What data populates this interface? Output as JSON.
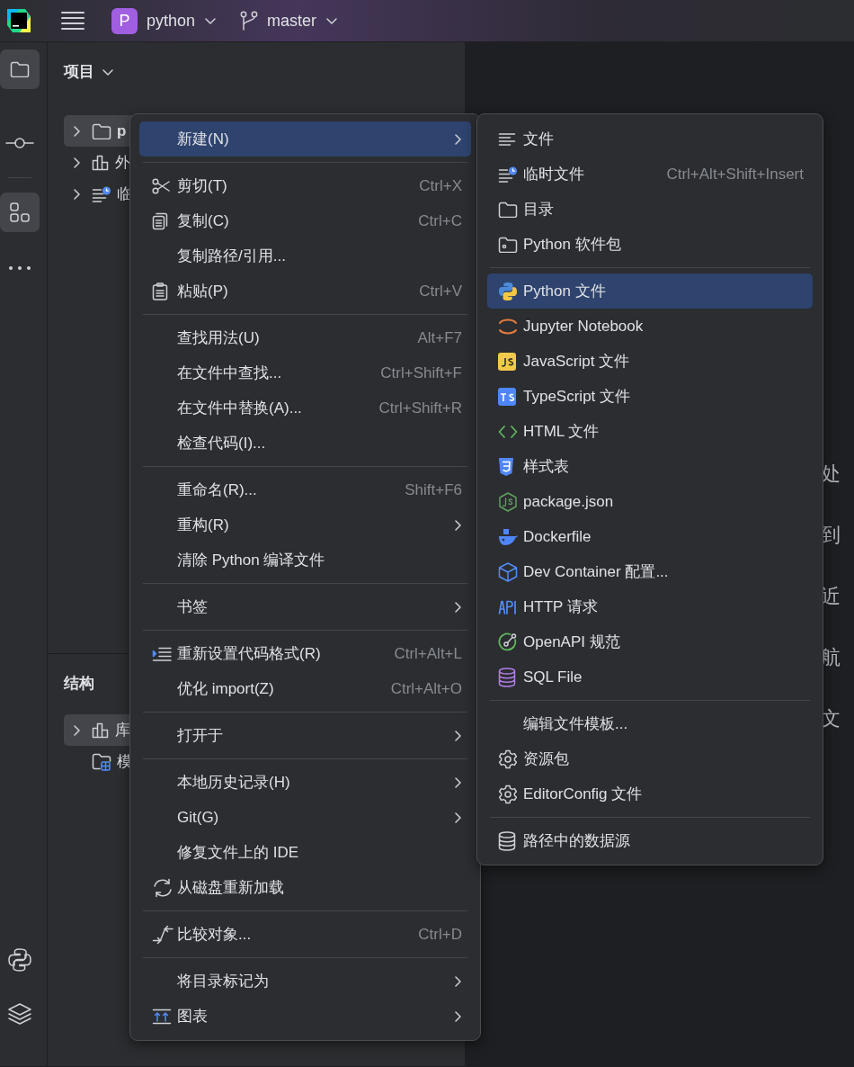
{
  "top_bar": {
    "project_initial": "P",
    "project": "python",
    "branch": "master"
  },
  "tool_rail": {
    "top": [
      {
        "kind": "folder",
        "selected": true
      },
      {
        "kind": "commit",
        "selected": false
      },
      {
        "kind": "structure",
        "selected": true
      },
      {
        "kind": "more",
        "selected": false
      }
    ],
    "bottom": [
      {
        "kind": "python",
        "selected": false
      },
      {
        "kind": "layers",
        "selected": false
      }
    ]
  },
  "project_panel": {
    "title": "项目",
    "tree": [
      {
        "label": "p",
        "kind": "folder",
        "selected": true
      },
      {
        "label": "外",
        "kind": "library",
        "selected": false
      },
      {
        "label": "临",
        "kind": "scratch",
        "selected": false
      }
    ]
  },
  "structure_panel": {
    "title": "结构",
    "tree": [
      {
        "label": "库",
        "kind": "library",
        "selected": true,
        "expandable": true
      },
      {
        "label": "模",
        "kind": "module",
        "selected": false,
        "expandable": false
      }
    ]
  },
  "editor_hints": [
    "处",
    "到",
    "近",
    "航",
    "文"
  ],
  "context_menu": {
    "sections": [
      [
        {
          "label": "新建(N)",
          "submenu": true,
          "selected": true
        }
      ],
      [
        {
          "label": "剪切(T)",
          "kind": "scissors",
          "shortcut": "Ctrl+X",
          "selected": false
        },
        {
          "label": "复制(C)",
          "kind": "copy",
          "shortcut": "Ctrl+C",
          "selected": false
        },
        {
          "label": "复制路径/引用...",
          "selected": false
        },
        {
          "label": "粘贴(P)",
          "kind": "paste",
          "shortcut": "Ctrl+V",
          "selected": false
        }
      ],
      [
        {
          "label": "查找用法(U)",
          "shortcut": "Alt+F7",
          "selected": false
        },
        {
          "label": "在文件中查找...",
          "shortcut": "Ctrl+Shift+F",
          "selected": false
        },
        {
          "label": "在文件中替换(A)...",
          "shortcut": "Ctrl+Shift+R",
          "selected": false
        },
        {
          "label": "检查代码(I)...",
          "selected": false
        }
      ],
      [
        {
          "label": "重命名(R)...",
          "shortcut": "Shift+F6",
          "selected": false
        },
        {
          "label": "重构(R)",
          "submenu": true,
          "selected": false
        },
        {
          "label": "清除 Python 编译文件",
          "selected": false
        }
      ],
      [
        {
          "label": "书签",
          "submenu": true,
          "selected": false
        }
      ],
      [
        {
          "label": "重新设置代码格式(R)",
          "kind": "reformat",
          "shortcut": "Ctrl+Alt+L",
          "selected": false
        },
        {
          "label": "优化 import(Z)",
          "shortcut": "Ctrl+Alt+O",
          "selected": false
        }
      ],
      [
        {
          "label": "打开于",
          "submenu": true,
          "selected": false
        }
      ],
      [
        {
          "label": "本地历史记录(H)",
          "submenu": true,
          "selected": false
        },
        {
          "label": "Git(G)",
          "submenu": true,
          "selected": false
        },
        {
          "label": "修复文件上的 IDE",
          "selected": false
        },
        {
          "label": "从磁盘重新加载",
          "kind": "reload",
          "selected": false
        }
      ],
      [
        {
          "label": "比较对象...",
          "kind": "compare",
          "shortcut": "Ctrl+D",
          "selected": false
        }
      ],
      [
        {
          "label": "将目录标记为",
          "submenu": true,
          "selected": false
        },
        {
          "label": "图表",
          "kind": "diagram",
          "submenu": true,
          "selected": false
        }
      ]
    ]
  },
  "new_submenu": {
    "sections": [
      [
        {
          "label": "文件",
          "kind": "text",
          "selected": false
        },
        {
          "label": "临时文件",
          "kind": "scratch",
          "shortcut": "Ctrl+Alt+Shift+Insert",
          "selected": false
        },
        {
          "label": "目录",
          "kind": "folder",
          "selected": false
        },
        {
          "label": "Python 软件包",
          "kind": "package",
          "selected": false
        }
      ],
      [
        {
          "label": "Python 文件",
          "kind": "python",
          "selected": true
        },
        {
          "label": "Jupyter Notebook",
          "kind": "jupyter",
          "selected": false
        },
        {
          "label": "JavaScript 文件",
          "kind": "js",
          "selected": false
        },
        {
          "label": "TypeScript 文件",
          "kind": "ts",
          "selected": false
        },
        {
          "label": "HTML 文件",
          "kind": "html",
          "selected": false
        },
        {
          "label": "样式表",
          "kind": "css",
          "selected": false
        },
        {
          "label": "package.json",
          "kind": "node",
          "selected": false
        },
        {
          "label": "Dockerfile",
          "kind": "docker",
          "selected": false
        },
        {
          "label": "Dev Container 配置...",
          "kind": "cube",
          "selected": false
        },
        {
          "label": "HTTP 请求",
          "kind": "api",
          "selected": false
        },
        {
          "label": "OpenAPI 规范",
          "kind": "openapi",
          "selected": false
        },
        {
          "label": "SQL File",
          "kind": "sql",
          "selected": false
        }
      ],
      [
        {
          "label": "编辑文件模板...",
          "selected": false
        },
        {
          "label": "资源包",
          "kind": "gear",
          "selected": false
        },
        {
          "label": "EditorConfig 文件",
          "kind": "gear",
          "selected": false
        }
      ],
      [
        {
          "label": "路径中的数据源",
          "kind": "database",
          "selected": false
        }
      ]
    ]
  }
}
